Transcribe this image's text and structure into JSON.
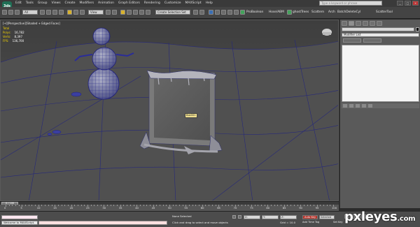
{
  "app": {
    "logo_text": "3ds",
    "menu": [
      "Edit",
      "Tools",
      "Group",
      "Views",
      "Create",
      "Modifiers",
      "Animation",
      "Graph Editors",
      "Rendering",
      "Customize",
      "MAXScript",
      "Help"
    ],
    "search_placeholder": "Type a keyword or phrase",
    "window_buttons": [
      "_",
      "□",
      "×"
    ]
  },
  "toolbar": {
    "filter_value": "All",
    "view_value": "View",
    "selection_set_value": "Create Selection Set",
    "labels": [
      "ProBoolean",
      "Hose/ABM",
      "ghostTrees",
      "Scattern",
      "Arch",
      "BatchDeleteCyl",
      "ScatterTool"
    ]
  },
  "viewport": {
    "label": "[+][Perspective][Shaded + Edged Faces]",
    "stats": [
      {
        "key": "Total",
        "value": ""
      },
      {
        "key": "Polys:",
        "value": "16,782"
      },
      {
        "key": "Verts:",
        "value": "8,397"
      },
      {
        "key": "FPS:",
        "value": "136,700"
      }
    ],
    "object_tag": "Box001"
  },
  "command_panel": {
    "modifier_list": "Modifier List"
  },
  "timeline": {
    "slider_label": "0 / 100",
    "ticks": [
      "0",
      "5",
      "10",
      "15",
      "20",
      "25",
      "30",
      "35",
      "40",
      "45",
      "50",
      "55",
      "60",
      "65",
      "70",
      "75",
      "80",
      "85",
      "90",
      "95",
      "100"
    ]
  },
  "status": {
    "listener_text": "Welcome to MAXScript.",
    "selection_text": "None Selected",
    "prompt_text": "Click and drag to select and move objects",
    "x_value": "X:",
    "y_value": "Y:",
    "z_value": "Z:",
    "grid_text": "Grid = 10.0",
    "autokey_label": "Auto Key",
    "selected_label": "Selected",
    "timetag_label": "Add Time Tag",
    "setkey_label": "Set Key"
  },
  "watermark": {
    "main": "pxleyes",
    "suffix": ".com"
  }
}
